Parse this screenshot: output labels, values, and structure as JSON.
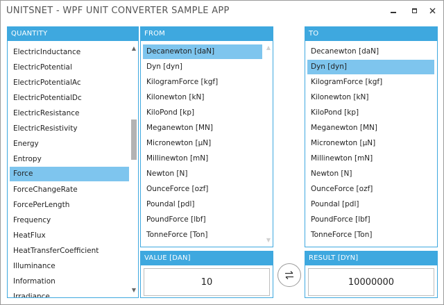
{
  "window": {
    "title": "UNITSNET - WPF UNIT CONVERTER SAMPLE APP",
    "accent_color": "#3ea8df",
    "selection_color": "#7ec5ee"
  },
  "quantity_panel": {
    "header": "QUANTITY",
    "items": [
      "ElectricInductance",
      "ElectricPotential",
      "ElectricPotentialAc",
      "ElectricPotentialDc",
      "ElectricResistance",
      "ElectricResistivity",
      "Energy",
      "Entropy",
      "Force",
      "ForceChangeRate",
      "ForcePerLength",
      "Frequency",
      "HeatFlux",
      "HeatTransferCoefficient",
      "Illuminance",
      "Information",
      "Irradiance"
    ],
    "selected": "Force"
  },
  "from_panel": {
    "header": "FROM",
    "items": [
      "Decanewton [daN]",
      "Dyn [dyn]",
      "KilogramForce [kgf]",
      "Kilonewton [kN]",
      "KiloPond [kp]",
      "Meganewton [MN]",
      "Micronewton [µN]",
      "Millinewton [mN]",
      "Newton [N]",
      "OunceForce [ozf]",
      "Poundal [pdl]",
      "PoundForce [lbf]",
      "TonneForce [Ton]"
    ],
    "selected": "Decanewton [daN]"
  },
  "to_panel": {
    "header": "TO",
    "items": [
      "Decanewton [daN]",
      "Dyn [dyn]",
      "KilogramForce [kgf]",
      "Kilonewton [kN]",
      "KiloPond [kp]",
      "Meganewton [MN]",
      "Micronewton [µN]",
      "Millinewton [mN]",
      "Newton [N]",
      "OunceForce [ozf]",
      "Poundal [pdl]",
      "PoundForce [lbf]",
      "TonneForce [Ton]"
    ],
    "selected": "Dyn [dyn]"
  },
  "value_panel": {
    "header": "VALUE [DAN]",
    "value": "10"
  },
  "result_panel": {
    "header": "RESULT [DYN]",
    "value": "10000000"
  },
  "icons": {
    "minimize": "minimize-icon",
    "maximize": "maximize-icon",
    "close": "close-icon",
    "swap": "swap-arrows-icon",
    "scroll_up": "chevron-up-icon",
    "scroll_down": "chevron-down-icon"
  }
}
